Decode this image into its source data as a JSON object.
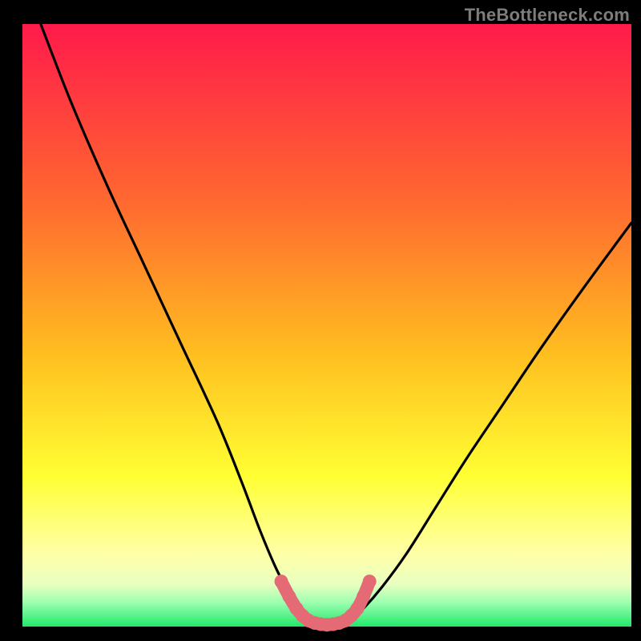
{
  "watermark": "TheBottleneck.com",
  "colors": {
    "bg_black": "#000000",
    "grad_top": "#ff1a4b",
    "grad_mid1": "#ff7a2d",
    "grad_mid2": "#ffd21f",
    "grad_low": "#ffff66",
    "grad_pale": "#f8ffc8",
    "grad_green": "#1ef06b",
    "curve": "#000000",
    "marker": "#e46a76"
  },
  "chart_data": {
    "type": "line",
    "title": "",
    "xlabel": "",
    "ylabel": "",
    "xlim": [
      0,
      100
    ],
    "ylim": [
      0,
      100
    ],
    "series": [
      {
        "name": "bottleneck-curve",
        "x": [
          3,
          8,
          14,
          20,
          26,
          32,
          36,
          39,
          41.5,
          43.5,
          45,
          46.5,
          48,
          50,
          52,
          54,
          56,
          59,
          63,
          68,
          73,
          79,
          85,
          92,
          100
        ],
        "y": [
          100,
          87,
          73,
          60,
          47,
          34,
          24,
          16,
          10,
          6,
          3,
          1.2,
          0.4,
          0.2,
          0.4,
          1.2,
          3,
          6.5,
          12,
          20,
          28,
          37,
          46,
          56,
          67
        ]
      }
    ],
    "markers": {
      "name": "bottom-markers",
      "x": [
        42.5,
        43.8,
        45,
        46,
        47,
        48,
        49,
        50,
        51,
        52,
        53,
        54,
        55,
        56,
        57
      ],
      "y": [
        7.5,
        5,
        3,
        1.8,
        1,
        0.6,
        0.4,
        0.3,
        0.4,
        0.6,
        1,
        1.8,
        3,
        5,
        7.5
      ]
    },
    "gradient_bands_pct_from_top": [
      {
        "stop": 0,
        "color": "#ff1a4b"
      },
      {
        "stop": 30,
        "color": "#ff6a2f"
      },
      {
        "stop": 55,
        "color": "#ffbf20"
      },
      {
        "stop": 75,
        "color": "#ffff33"
      },
      {
        "stop": 88,
        "color": "#ffffa8"
      },
      {
        "stop": 93,
        "color": "#e8ffc0"
      },
      {
        "stop": 96,
        "color": "#9cffb0"
      },
      {
        "stop": 100,
        "color": "#22e86b"
      }
    ]
  }
}
